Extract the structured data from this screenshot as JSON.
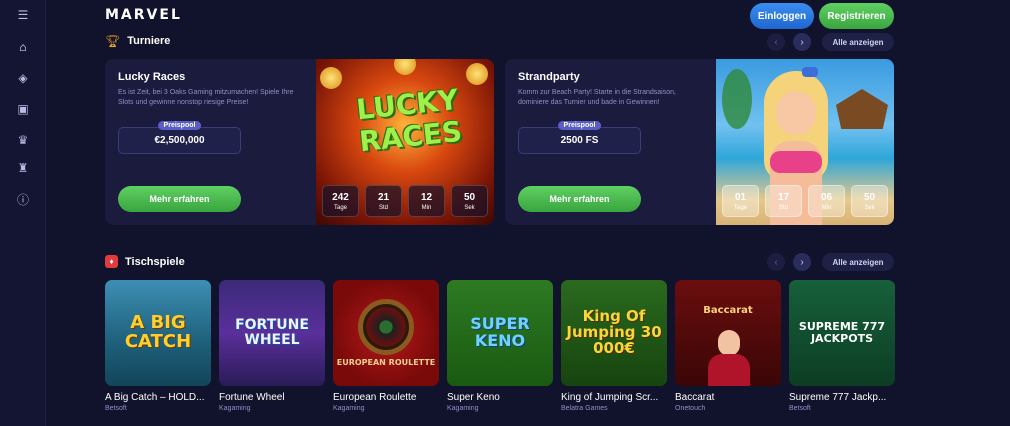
{
  "header": {
    "logo": "MARVEL",
    "login_label": "Einloggen",
    "register_label": "Registrieren"
  },
  "sidebar": {
    "items": [
      {
        "name": "menu-icon",
        "glyph": "☰"
      },
      {
        "name": "home-icon",
        "glyph": "⌂"
      },
      {
        "name": "chips-icon",
        "glyph": "◈"
      },
      {
        "name": "gift-icon",
        "glyph": "▣"
      },
      {
        "name": "crown-icon",
        "glyph": "♛"
      },
      {
        "name": "trophy-icon",
        "glyph": "♜"
      },
      {
        "name": "info-icon",
        "glyph": "ⓘ"
      }
    ]
  },
  "tournaments": {
    "title": "Turniere",
    "show_all_label": "Alle anzeigen",
    "cards": [
      {
        "title": "Lucky Races",
        "description": "Es ist Zeit, bei 3 Oaks Gaming mitzumachen! Spiele Ihre Slots und gewinne nonstop riesige Preise!",
        "prize_label": "Preispool",
        "prize_value": "€2,500,000",
        "cta_label": "Mehr erfahren",
        "image_text": "LUCKY RACES",
        "timer": [
          {
            "value": "242",
            "unit": "Tage"
          },
          {
            "value": "21",
            "unit": "Std"
          },
          {
            "value": "12",
            "unit": "Min"
          },
          {
            "value": "50",
            "unit": "Sek"
          }
        ]
      },
      {
        "title": "Strandparty",
        "description": "Komm zur Beach Party! Starte in die Strandsaison, dominiere das Turnier und bade in Gewinnen!",
        "prize_label": "Preispool",
        "prize_value": "2500 FS",
        "cta_label": "Mehr erfahren",
        "timer": [
          {
            "value": "01",
            "unit": "Tage"
          },
          {
            "value": "17",
            "unit": "Std"
          },
          {
            "value": "06",
            "unit": "Min"
          },
          {
            "value": "50",
            "unit": "Sek"
          }
        ]
      }
    ]
  },
  "table_games": {
    "title": "Tischspiele",
    "show_all_label": "Alle anzeigen",
    "games": [
      {
        "name": "A Big Catch – HOLD...",
        "provider": "Betsoft",
        "thumb_text": "A BIG CATCH"
      },
      {
        "name": "Fortune Wheel",
        "provider": "Kagaming",
        "thumb_text": "FORTUNE WHEEL"
      },
      {
        "name": "European Roulette",
        "provider": "Kagaming",
        "thumb_text": "EUROPEAN ROULETTE"
      },
      {
        "name": "Super Keno",
        "provider": "Kagaming",
        "thumb_text": "SUPER KENO"
      },
      {
        "name": "King of Jumping Scr...",
        "provider": "Belatra Games",
        "thumb_text": "King Of Jumping 30 000€"
      },
      {
        "name": "Baccarat",
        "provider": "Onetouch",
        "thumb_text": "Baccarat"
      },
      {
        "name": "Supreme 777 Jackp...",
        "provider": "Betsoft",
        "thumb_text": "SUPREME 777 JACKPOTS"
      }
    ]
  }
}
